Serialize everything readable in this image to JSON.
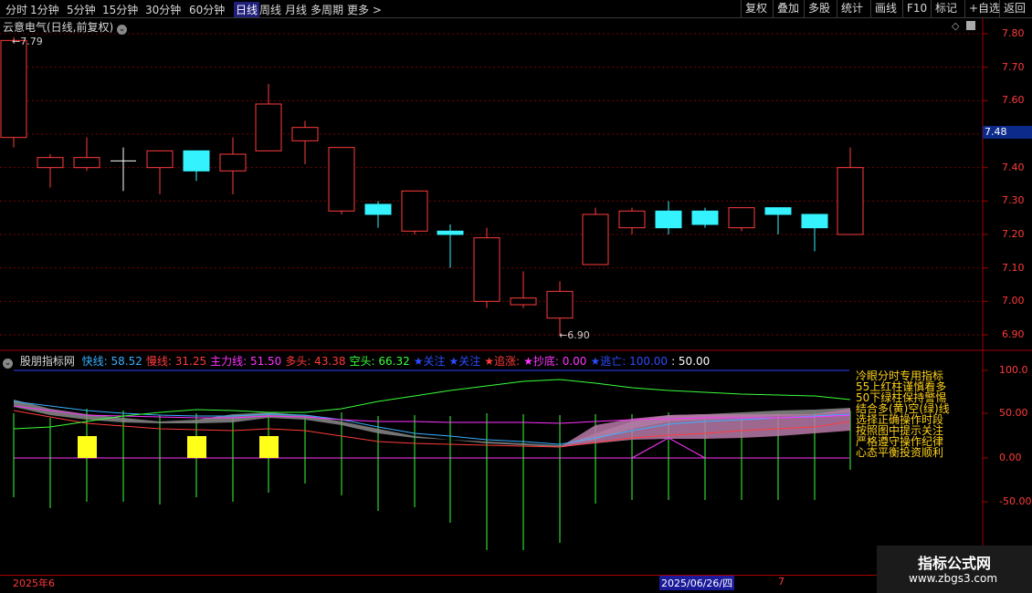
{
  "toolbar": {
    "tabs": [
      {
        "label": "分时",
        "x": 6
      },
      {
        "label": "1分钟",
        "x": 33
      },
      {
        "label": "5分钟",
        "x": 73
      },
      {
        "label": "15分钟",
        "x": 112
      },
      {
        "label": "30分钟",
        "x": 159
      },
      {
        "label": "60分钟",
        "x": 207
      },
      {
        "label": "日线",
        "x": 256
      },
      {
        "label": "周线",
        "x": 284
      },
      {
        "label": "月线",
        "x": 312
      },
      {
        "label": "多周期",
        "x": 340
      },
      {
        "label": "更多 >",
        "x": 380
      }
    ],
    "active_tab": "日线",
    "right_buttons": [
      "复权",
      "叠加",
      "多股",
      "统计",
      "画线",
      "F10",
      "标记",
      "+自选",
      "返回"
    ]
  },
  "chart_title": "云意电气(日线,前复权)",
  "price_labels": {
    "high": "7.79",
    "low": "6.90"
  },
  "current_price": "7.48",
  "price_axis_ticks": [
    "7.80",
    "7.70",
    "7.60",
    "7.50",
    "7.40",
    "7.30",
    "7.20",
    "7.10",
    "7.00",
    "6.90"
  ],
  "indicator": {
    "name": "股朋指标网",
    "items": [
      {
        "label": "快线:",
        "value": "58.52",
        "color": "#3ab0ff"
      },
      {
        "label": "慢线:",
        "value": "31.25",
        "color": "#ff3b3b"
      },
      {
        "label": "主力线:",
        "value": "51.50",
        "color": "#ff33ff"
      },
      {
        "label": "多头:",
        "value": "43.38",
        "color": "#ff3b3b"
      },
      {
        "label": "空头:",
        "value": "66.32",
        "color": "#3aff3a"
      },
      {
        "label": "★关注",
        "value": "",
        "color": "#2d4bff"
      },
      {
        "label": "★关注",
        "value": "",
        "color": "#2d4bff"
      },
      {
        "label": "★追涨:",
        "value": "",
        "color": "#ff3b3b"
      },
      {
        "label": "★抄底:",
        "value": "0.00",
        "color": "#ff33ff"
      },
      {
        "label": "★逃亡:",
        "value": "100.00",
        "color": "#2d4bff"
      },
      {
        "label": ":",
        "value": "50.00",
        "color": "#ffffff"
      }
    ],
    "axis_ticks": [
      "100.0",
      "50.00",
      "0.00",
      "-50.00"
    ],
    "notes": [
      "冷眼分时专用指标",
      "55上红柱谨慎看多",
      "50下绿柱保持警惕",
      "结合多(黄)空(绿)线",
      "选择正确操作时段",
      "按照图中提示关注",
      "严格遵守操作纪律",
      "心态平衡投资顺利"
    ]
  },
  "dates": {
    "left": "2025年6",
    "selected": "2025/06/26/四",
    "right": "7"
  },
  "watermark": {
    "line1": "指标公式网",
    "line2": "www.zbgs3.com"
  },
  "chart_data": {
    "type": "candlestick",
    "ylim": [
      6.85,
      7.85
    ],
    "candles": [
      {
        "o": 7.49,
        "c": 7.78,
        "h": 7.79,
        "l": 7.46
      },
      {
        "o": 7.4,
        "c": 7.43,
        "h": 7.44,
        "l": 7.34
      },
      {
        "o": 7.4,
        "c": 7.43,
        "h": 7.49,
        "l": 7.39
      },
      {
        "o": 7.42,
        "c": 7.42,
        "h": 7.46,
        "l": 7.33
      },
      {
        "o": 7.4,
        "c": 7.45,
        "h": 7.45,
        "l": 7.32
      },
      {
        "o": 7.45,
        "c": 7.39,
        "h": 7.45,
        "l": 7.36
      },
      {
        "o": 7.39,
        "c": 7.44,
        "h": 7.49,
        "l": 7.32
      },
      {
        "o": 7.45,
        "c": 7.59,
        "h": 7.65,
        "l": 7.45
      },
      {
        "o": 7.48,
        "c": 7.52,
        "h": 7.54,
        "l": 7.41
      },
      {
        "o": 7.27,
        "c": 7.46,
        "h": 7.46,
        "l": 7.26
      },
      {
        "o": 7.29,
        "c": 7.26,
        "h": 7.3,
        "l": 7.22
      },
      {
        "o": 7.21,
        "c": 7.33,
        "h": 7.33,
        "l": 7.2
      },
      {
        "o": 7.21,
        "c": 7.2,
        "h": 7.23,
        "l": 7.1
      },
      {
        "o": 7.0,
        "c": 7.19,
        "h": 7.22,
        "l": 6.98
      },
      {
        "o": 6.99,
        "c": 7.01,
        "h": 7.09,
        "l": 6.98
      },
      {
        "o": 6.95,
        "c": 7.03,
        "h": 7.06,
        "l": 6.9
      },
      {
        "o": 7.11,
        "c": 7.26,
        "h": 7.28,
        "l": 7.11
      },
      {
        "o": 7.22,
        "c": 7.27,
        "h": 7.28,
        "l": 7.2
      },
      {
        "o": 7.27,
        "c": 7.22,
        "h": 7.3,
        "l": 7.2
      },
      {
        "o": 7.27,
        "c": 7.23,
        "h": 7.28,
        "l": 7.22
      },
      {
        "o": 7.22,
        "c": 7.28,
        "h": 7.28,
        "l": 7.21
      },
      {
        "o": 7.28,
        "c": 7.26,
        "h": 7.28,
        "l": 7.2
      },
      {
        "o": 7.26,
        "c": 7.22,
        "h": 7.26,
        "l": 7.15
      },
      {
        "o": 7.2,
        "c": 7.4,
        "h": 7.46,
        "l": 7.2
      }
    ]
  }
}
